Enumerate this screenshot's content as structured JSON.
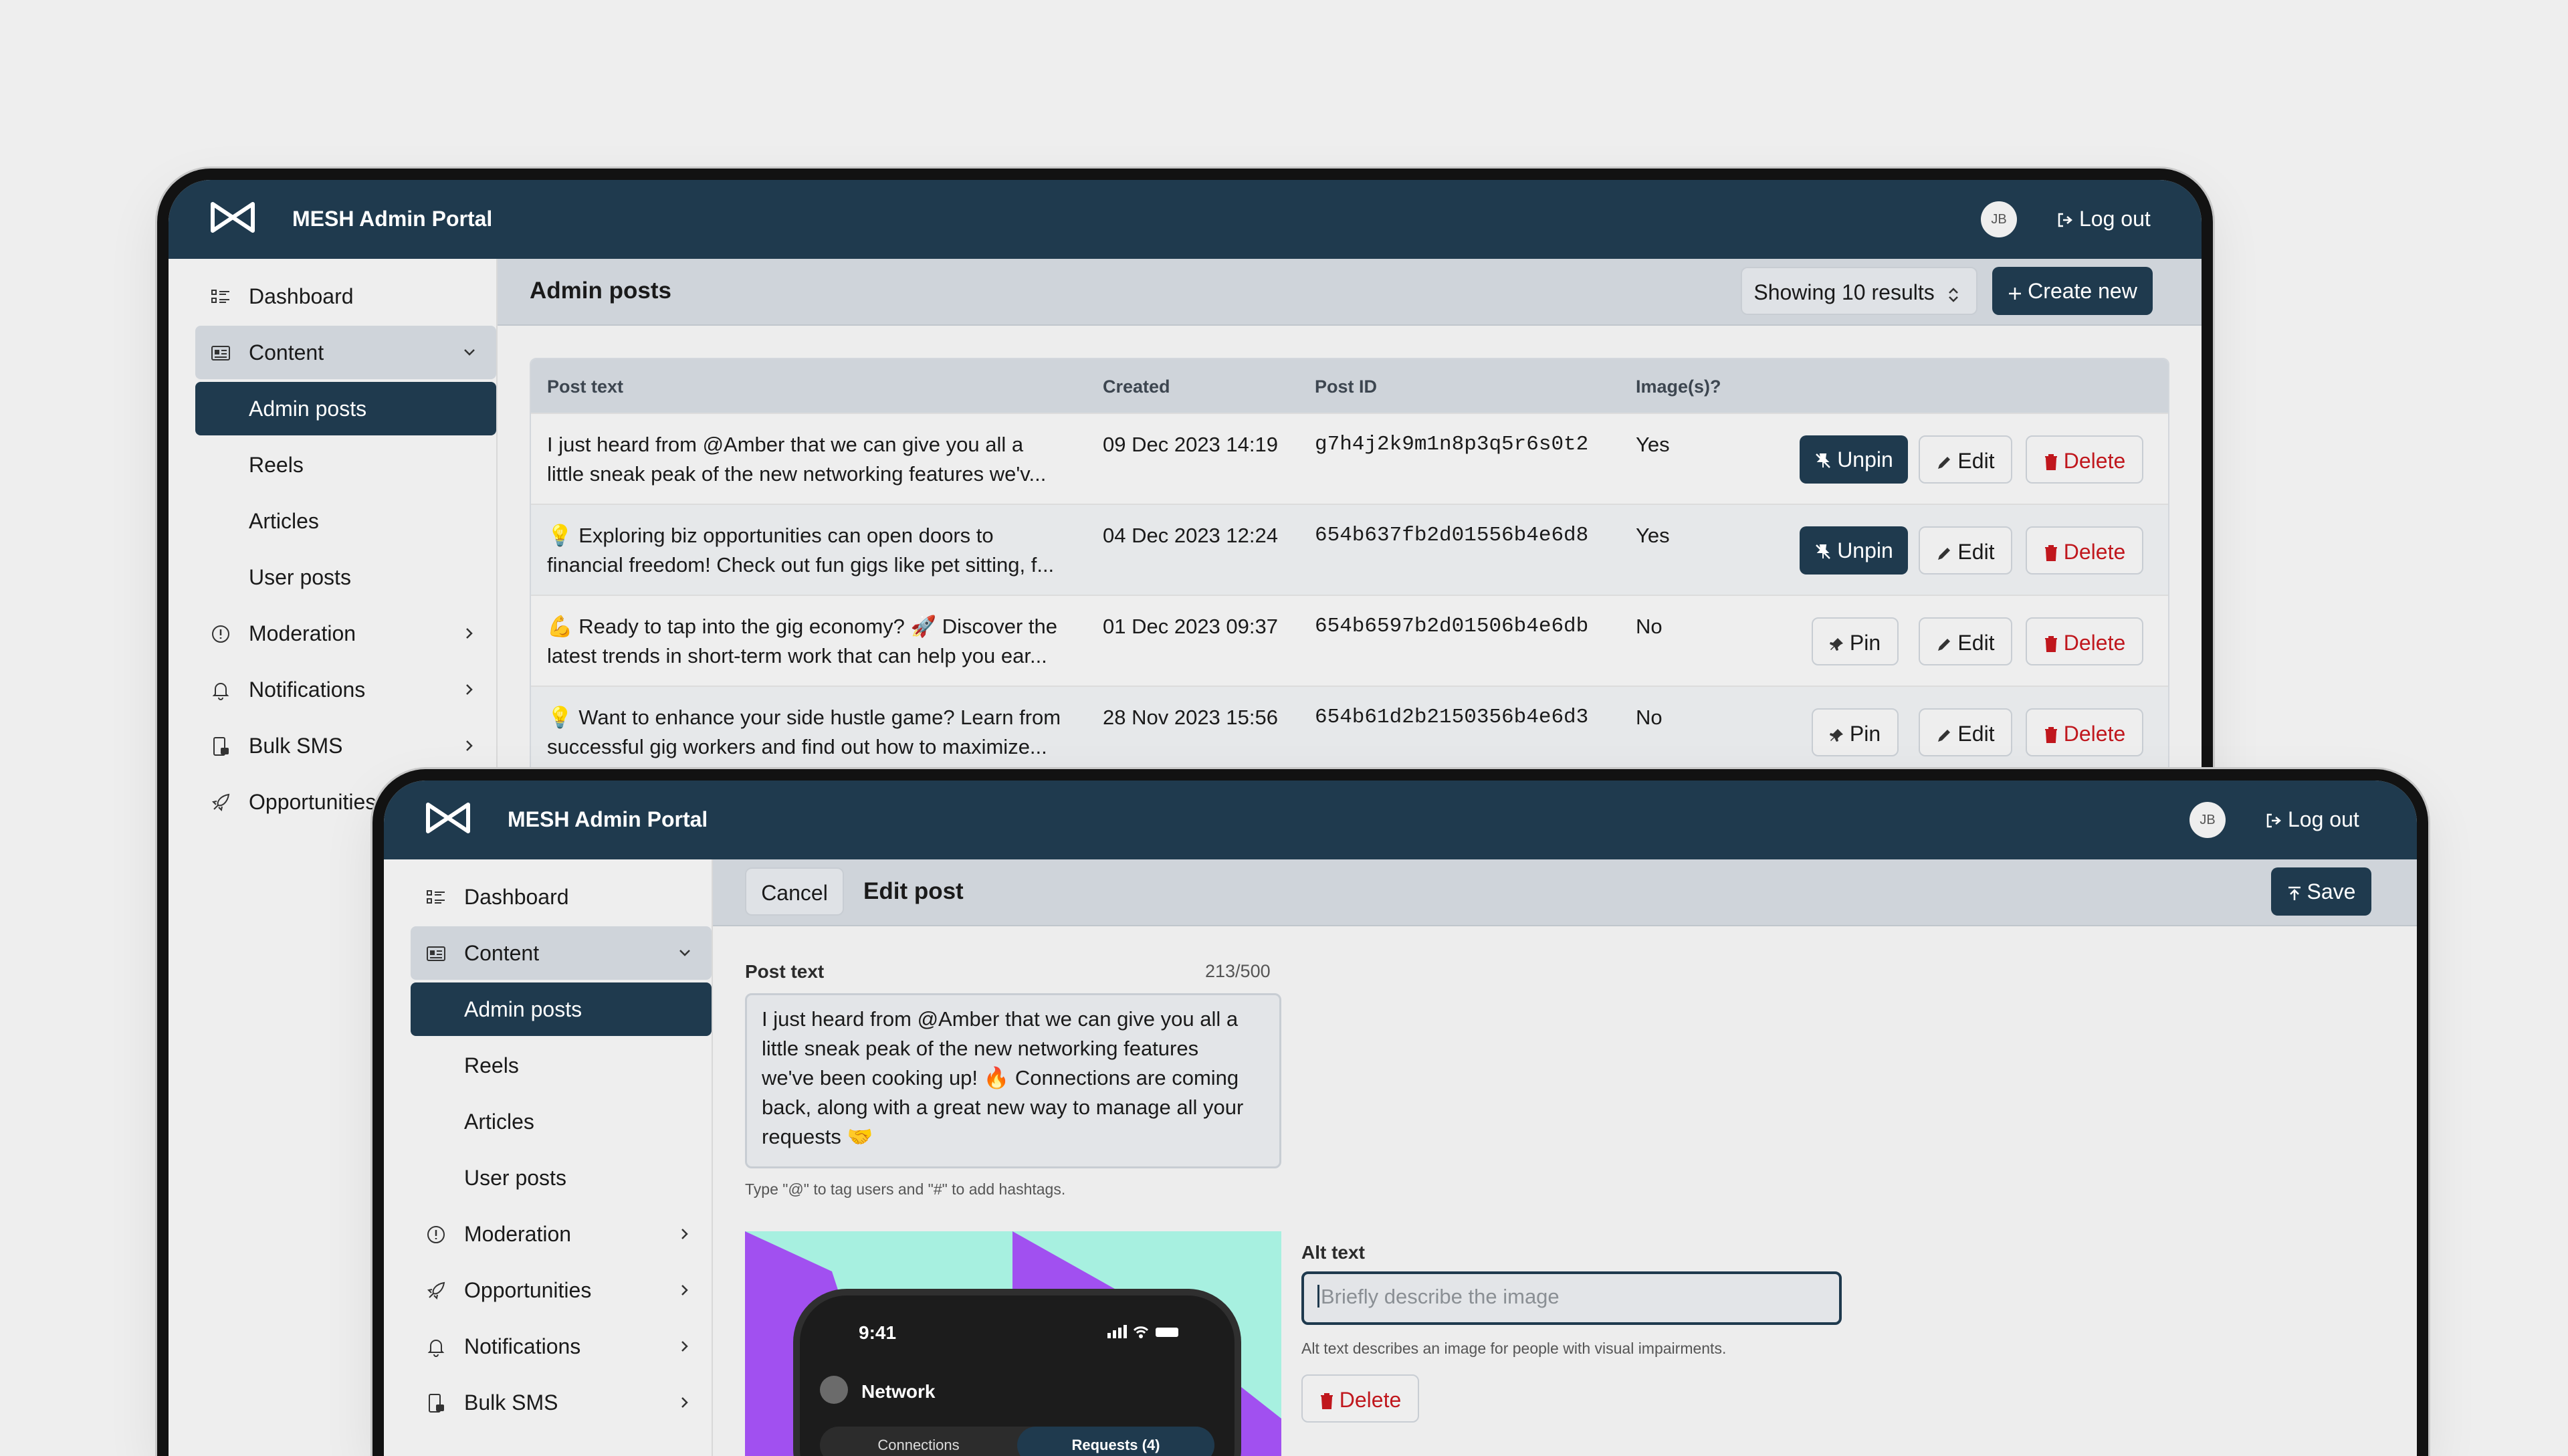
{
  "app": {
    "title": "MESH Admin Portal",
    "avatar_initials": "JB",
    "logout_label": "Log out"
  },
  "sidebar": {
    "items": [
      {
        "label": "Dashboard",
        "icon": "dashboard-icon"
      },
      {
        "label": "Content",
        "icon": "content-icon"
      },
      {
        "label": "Admin posts"
      },
      {
        "label": "Reels"
      },
      {
        "label": "Articles"
      },
      {
        "label": "User posts"
      },
      {
        "label": "Moderation",
        "icon": "moderation-icon"
      },
      {
        "label": "Notifications",
        "icon": "bell-icon"
      },
      {
        "label": "Bulk SMS",
        "icon": "sms-icon"
      },
      {
        "label": "Opportunities",
        "icon": "rocket-icon"
      }
    ]
  },
  "list_page": {
    "title": "Admin posts",
    "results_select": "Showing 10 results",
    "create_label": "Create new",
    "columns": [
      "Post text",
      "Created",
      "Post ID",
      "Image(s)?"
    ],
    "rows": [
      {
        "text1": "I just heard from @Amber that we can give you all a",
        "text2": "little sneak peak of the new networking features we'v...",
        "created": "09 Dec 2023 14:19",
        "id": "g7h4j2k9m1n8p3q5r6s0t2",
        "images": "Yes",
        "pin_label": "Unpin"
      },
      {
        "text1": "💡 Exploring biz opportunities can open doors to",
        "text2": "financial freedom! Check out fun gigs like pet sitting, f...",
        "created": "04 Dec 2023 12:24",
        "id": "654b637fb2d01556b4e6d8",
        "images": "Yes",
        "pin_label": "Unpin"
      },
      {
        "text1": "💪 Ready to tap into the gig economy? 🚀 Discover the",
        "text2": "latest trends in short-term work that can help you ear...",
        "created": "01 Dec 2023 09:37",
        "id": "654b6597b2d01506b4e6db",
        "images": "No",
        "pin_label": "Pin"
      },
      {
        "text1": "💡 Want to enhance your side hustle game? Learn from",
        "text2": "successful gig workers and find out how to maximize...",
        "created": "28 Nov 2023 15:56",
        "id": "654b61d2b2150356b4e6d3",
        "images": "No",
        "pin_label": "Pin"
      }
    ],
    "edit_label": "Edit",
    "delete_label": "Delete"
  },
  "edit_page": {
    "cancel_label": "Cancel",
    "title": "Edit post",
    "save_label": "Save",
    "post_text_label": "Post text",
    "char_count": "213/500",
    "post_text_lines": [
      "I just heard from @Amber that we can give you all a",
      "little sneak peak of the new networking features",
      "we've been cooking up! 🔥 Connections are coming",
      "back, along with a great new way to manage all your",
      "requests 🤝"
    ],
    "helper": "Type \"@\" to tag users and \"#\" to add hashtags.",
    "alt_label": "Alt text",
    "alt_placeholder": "Briefly describe the image",
    "alt_helper": "Alt text describes an image for people with visual impairments.",
    "delete_label": "Delete",
    "phone": {
      "time": "9:41",
      "title": "Network",
      "tab1": "Connections",
      "tab2": "Requests (4)"
    }
  },
  "colors": {
    "primary": "#1f3a4e",
    "danger": "#c0171d",
    "surface": "#eeeeee",
    "toolbar": "#cfd4da"
  }
}
